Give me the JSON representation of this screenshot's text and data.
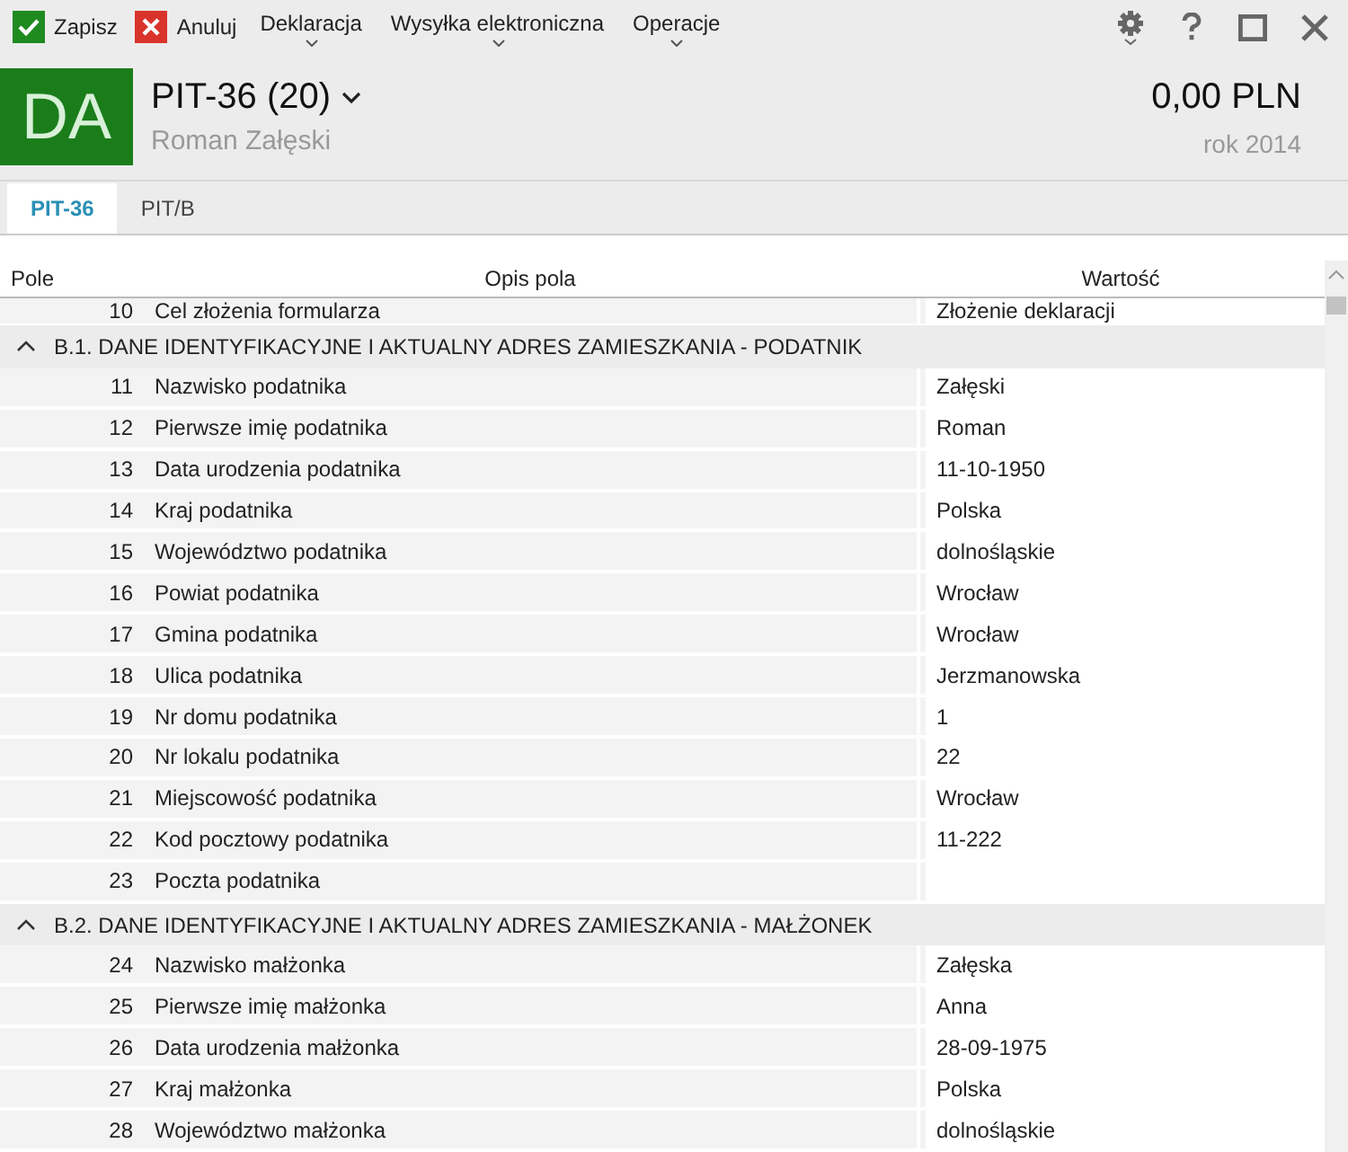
{
  "toolbar": {
    "actions": [
      {
        "kind": "save",
        "label": "Zapisz"
      },
      {
        "kind": "cancel",
        "label": "Anuluj"
      }
    ],
    "menus": [
      "Deklaracja",
      "Wysyłka elektroniczna",
      "Operacje"
    ]
  },
  "header": {
    "badge": "DA",
    "title": "PIT-36 (20)",
    "subtitle": "Roman Załęski",
    "amount": "0,00 PLN",
    "year": "rok 2014"
  },
  "tabs": [
    {
      "label": "PIT-36",
      "selected": true
    },
    {
      "label": "PIT/B",
      "selected": false
    }
  ],
  "grid": {
    "columns": [
      "Pole",
      "Opis pola",
      "Wartość"
    ],
    "items": [
      {
        "kind": "row",
        "number": "10",
        "label": "Cel złożenia formularza",
        "value": "Złożenie deklaracji"
      },
      {
        "kind": "section",
        "title": "B.1. DANE IDENTYFIKACYJNE I AKTUALNY ADRES ZAMIESZKANIA - PODATNIK",
        "expanded": true,
        "children": [
          {
            "kind": "row",
            "number": "11",
            "label": "Nazwisko podatnika",
            "value": "Załęski"
          },
          {
            "kind": "row",
            "number": "12",
            "label": "Pierwsze imię podatnika",
            "value": "Roman"
          },
          {
            "kind": "row",
            "number": "13",
            "label": "Data urodzenia podatnika",
            "value": "11-10-1950"
          },
          {
            "kind": "row",
            "number": "14",
            "label": "Kraj podatnika",
            "value": "Polska"
          },
          {
            "kind": "row",
            "number": "15",
            "label": "Województwo podatnika",
            "value": "dolnośląskie"
          },
          {
            "kind": "row",
            "number": "16",
            "label": "Powiat podatnika",
            "value": "Wrocław"
          },
          {
            "kind": "row",
            "number": "17",
            "label": "Gmina podatnika",
            "value": "Wrocław"
          },
          {
            "kind": "row",
            "number": "18",
            "label": "Ulica podatnika",
            "value": "Jerzmanowska"
          },
          {
            "kind": "row",
            "number": "19",
            "label": "Nr domu podatnika",
            "value": "1"
          },
          {
            "kind": "row",
            "number": "20",
            "label": "Nr lokalu podatnika",
            "value": "22"
          },
          {
            "kind": "row",
            "number": "21",
            "label": "Miejscowość podatnika",
            "value": "Wrocław"
          },
          {
            "kind": "row",
            "number": "22",
            "label": "Kod pocztowy podatnika",
            "value": "11-222"
          },
          {
            "kind": "row",
            "number": "23",
            "label": "Poczta podatnika"
          }
        ]
      },
      {
        "kind": "section",
        "title": "B.2. DANE IDENTYFIKACYJNE I AKTUALNY ADRES ZAMIESZKANIA - MAŁŻONEK",
        "expanded": true,
        "children": [
          {
            "kind": "row",
            "number": "24",
            "label": "Nazwisko małżonka",
            "value": "Załęska"
          },
          {
            "kind": "row",
            "number": "25",
            "label": "Pierwsze imię małżonka",
            "value": "Anna"
          },
          {
            "kind": "row",
            "number": "26",
            "label": "Data urodzenia małżonka",
            "value": "28-09-1975"
          },
          {
            "kind": "row",
            "number": "27",
            "label": "Kraj małżonka",
            "value": "Polska"
          },
          {
            "kind": "row",
            "number": "28",
            "label": "Województwo małżonka",
            "value": "dolnośląskie"
          }
        ]
      }
    ]
  }
}
